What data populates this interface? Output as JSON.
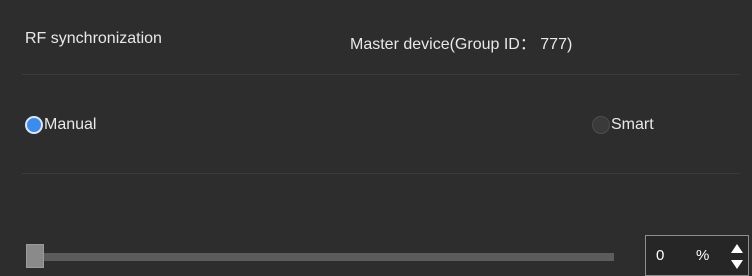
{
  "header": {
    "title": "RF synchronization",
    "master_label": "Master device(Group ID： 777)"
  },
  "mode": {
    "options": [
      {
        "label": "Manual",
        "checked": true
      },
      {
        "label": "Smart",
        "checked": false
      }
    ]
  },
  "level": {
    "value": "0",
    "unit": "%",
    "fraction": 0
  },
  "colors": {
    "background": "#2d2d2d",
    "accent": "#3c8cf0"
  },
  "icons": {
    "spin_up": "triangle-up-icon",
    "spin_down": "triangle-down-icon"
  }
}
